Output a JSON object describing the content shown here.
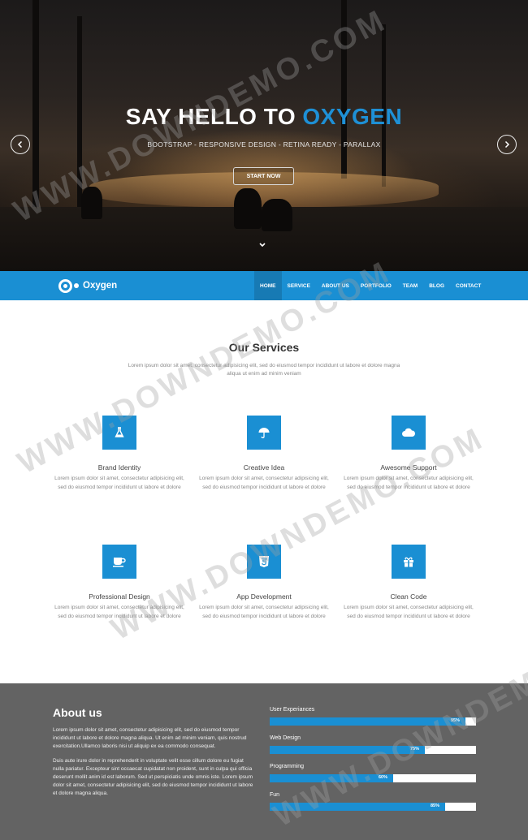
{
  "hero": {
    "title_main": "SAY HELLO TO ",
    "title_accent": "OXYGEN",
    "subtitle": "BOOTSTRAP - RESPONSIVE DESIGN - RETINA READY - PARALLAX",
    "cta_label": "START NOW",
    "prev_icon": "chevron-left-icon",
    "next_icon": "chevron-right-icon",
    "scroll_icon": "chevron-down-icon"
  },
  "nav": {
    "logo_text": "Oxygen",
    "items": [
      {
        "label": "HOME",
        "active": true
      },
      {
        "label": "SERVICE",
        "active": false
      },
      {
        "label": "ABOUT US",
        "active": false
      },
      {
        "label": "PORTFOLIO",
        "active": false
      },
      {
        "label": "TEAM",
        "active": false
      },
      {
        "label": "BLOG",
        "active": false
      },
      {
        "label": "CONTACT",
        "active": false
      }
    ]
  },
  "services": {
    "title": "Our Services",
    "intro": "Lorem ipsum dolor sit amet, consectetur adipisicing elit, sed do eiusmod tempor incididunt ut labore et dolore magna aliqua ut enim ad minim veniam",
    "items": [
      {
        "title": "Brand Identity",
        "icon": "flask-icon",
        "desc": "Lorem ipsum dolor sit amet, consectetur adipisicing elit, sed do eiusmod tempor incididunt ut labore et dolore"
      },
      {
        "title": "Creative Idea",
        "icon": "umbrella-icon",
        "desc": "Lorem ipsum dolor sit amet, consectetur adipisicing elit, sed do eiusmod tempor incididunt ut labore et dolore"
      },
      {
        "title": "Awesome Support",
        "icon": "cloud-icon",
        "desc": "Lorem ipsum dolor sit amet, consectetur adipisicing elit, sed do eiusmod tempor incididunt ut labore et dolore"
      },
      {
        "title": "Professional Design",
        "icon": "coffee-cup-icon",
        "desc": "Lorem ipsum dolor sit amet, consectetur adipisicing elit, sed do eiusmod tempor incididunt ut labore et dolore"
      },
      {
        "title": "App Development",
        "icon": "html5-icon",
        "desc": "Lorem ipsum dolor sit amet, consectetur adipisicing elit, sed do eiusmod tempor incididunt ut labore et dolore"
      },
      {
        "title": "Clean Code",
        "icon": "gift-icon",
        "desc": "Lorem ipsum dolor sit amet, consectetur adipisicing elit, sed do eiusmod tempor incididunt ut labore et dolore"
      }
    ]
  },
  "about": {
    "title": "About us",
    "p1": "Lorem ipsum dolor sit amet, consectetur adipisicing elit, sed do eiusmod tempor incididunt ut labore et dolore magna aliqua. Ut enim ad minim veniam, quis nostrud exercitation.Ullamco laboris nisi ut aliquip ex ea commodo consequat.",
    "p2": "Duis aute irure dolor in reprehenderit in voluptate velit esse cillum dolore eu fugiat nulla pariatur. Excepteur sint occaecat cupidatat non proident, sunt in culpa qui officia deserunt mollit anim id est laborum. Sed ut perspiciatis unde omnis iste. Lorem ipsum dolor sit amet, consectetur adipisicing elit, sed do eiusmod tempor incididunt ut labore et dolore magna aliqua.",
    "skills": [
      {
        "label": "User Experiances",
        "value": 95,
        "display": "95%"
      },
      {
        "label": "Web Design",
        "value": 75,
        "display": "75%"
      },
      {
        "label": "Programming",
        "value": 60,
        "display": "60%"
      },
      {
        "label": "Fun",
        "value": 85,
        "display": "85%"
      }
    ]
  },
  "watermark": "WWW.DOWNDEMO.COM",
  "colors": {
    "accent": "#1a8fd3",
    "nav_active": "#177ab4",
    "about_bg": "#636363"
  }
}
